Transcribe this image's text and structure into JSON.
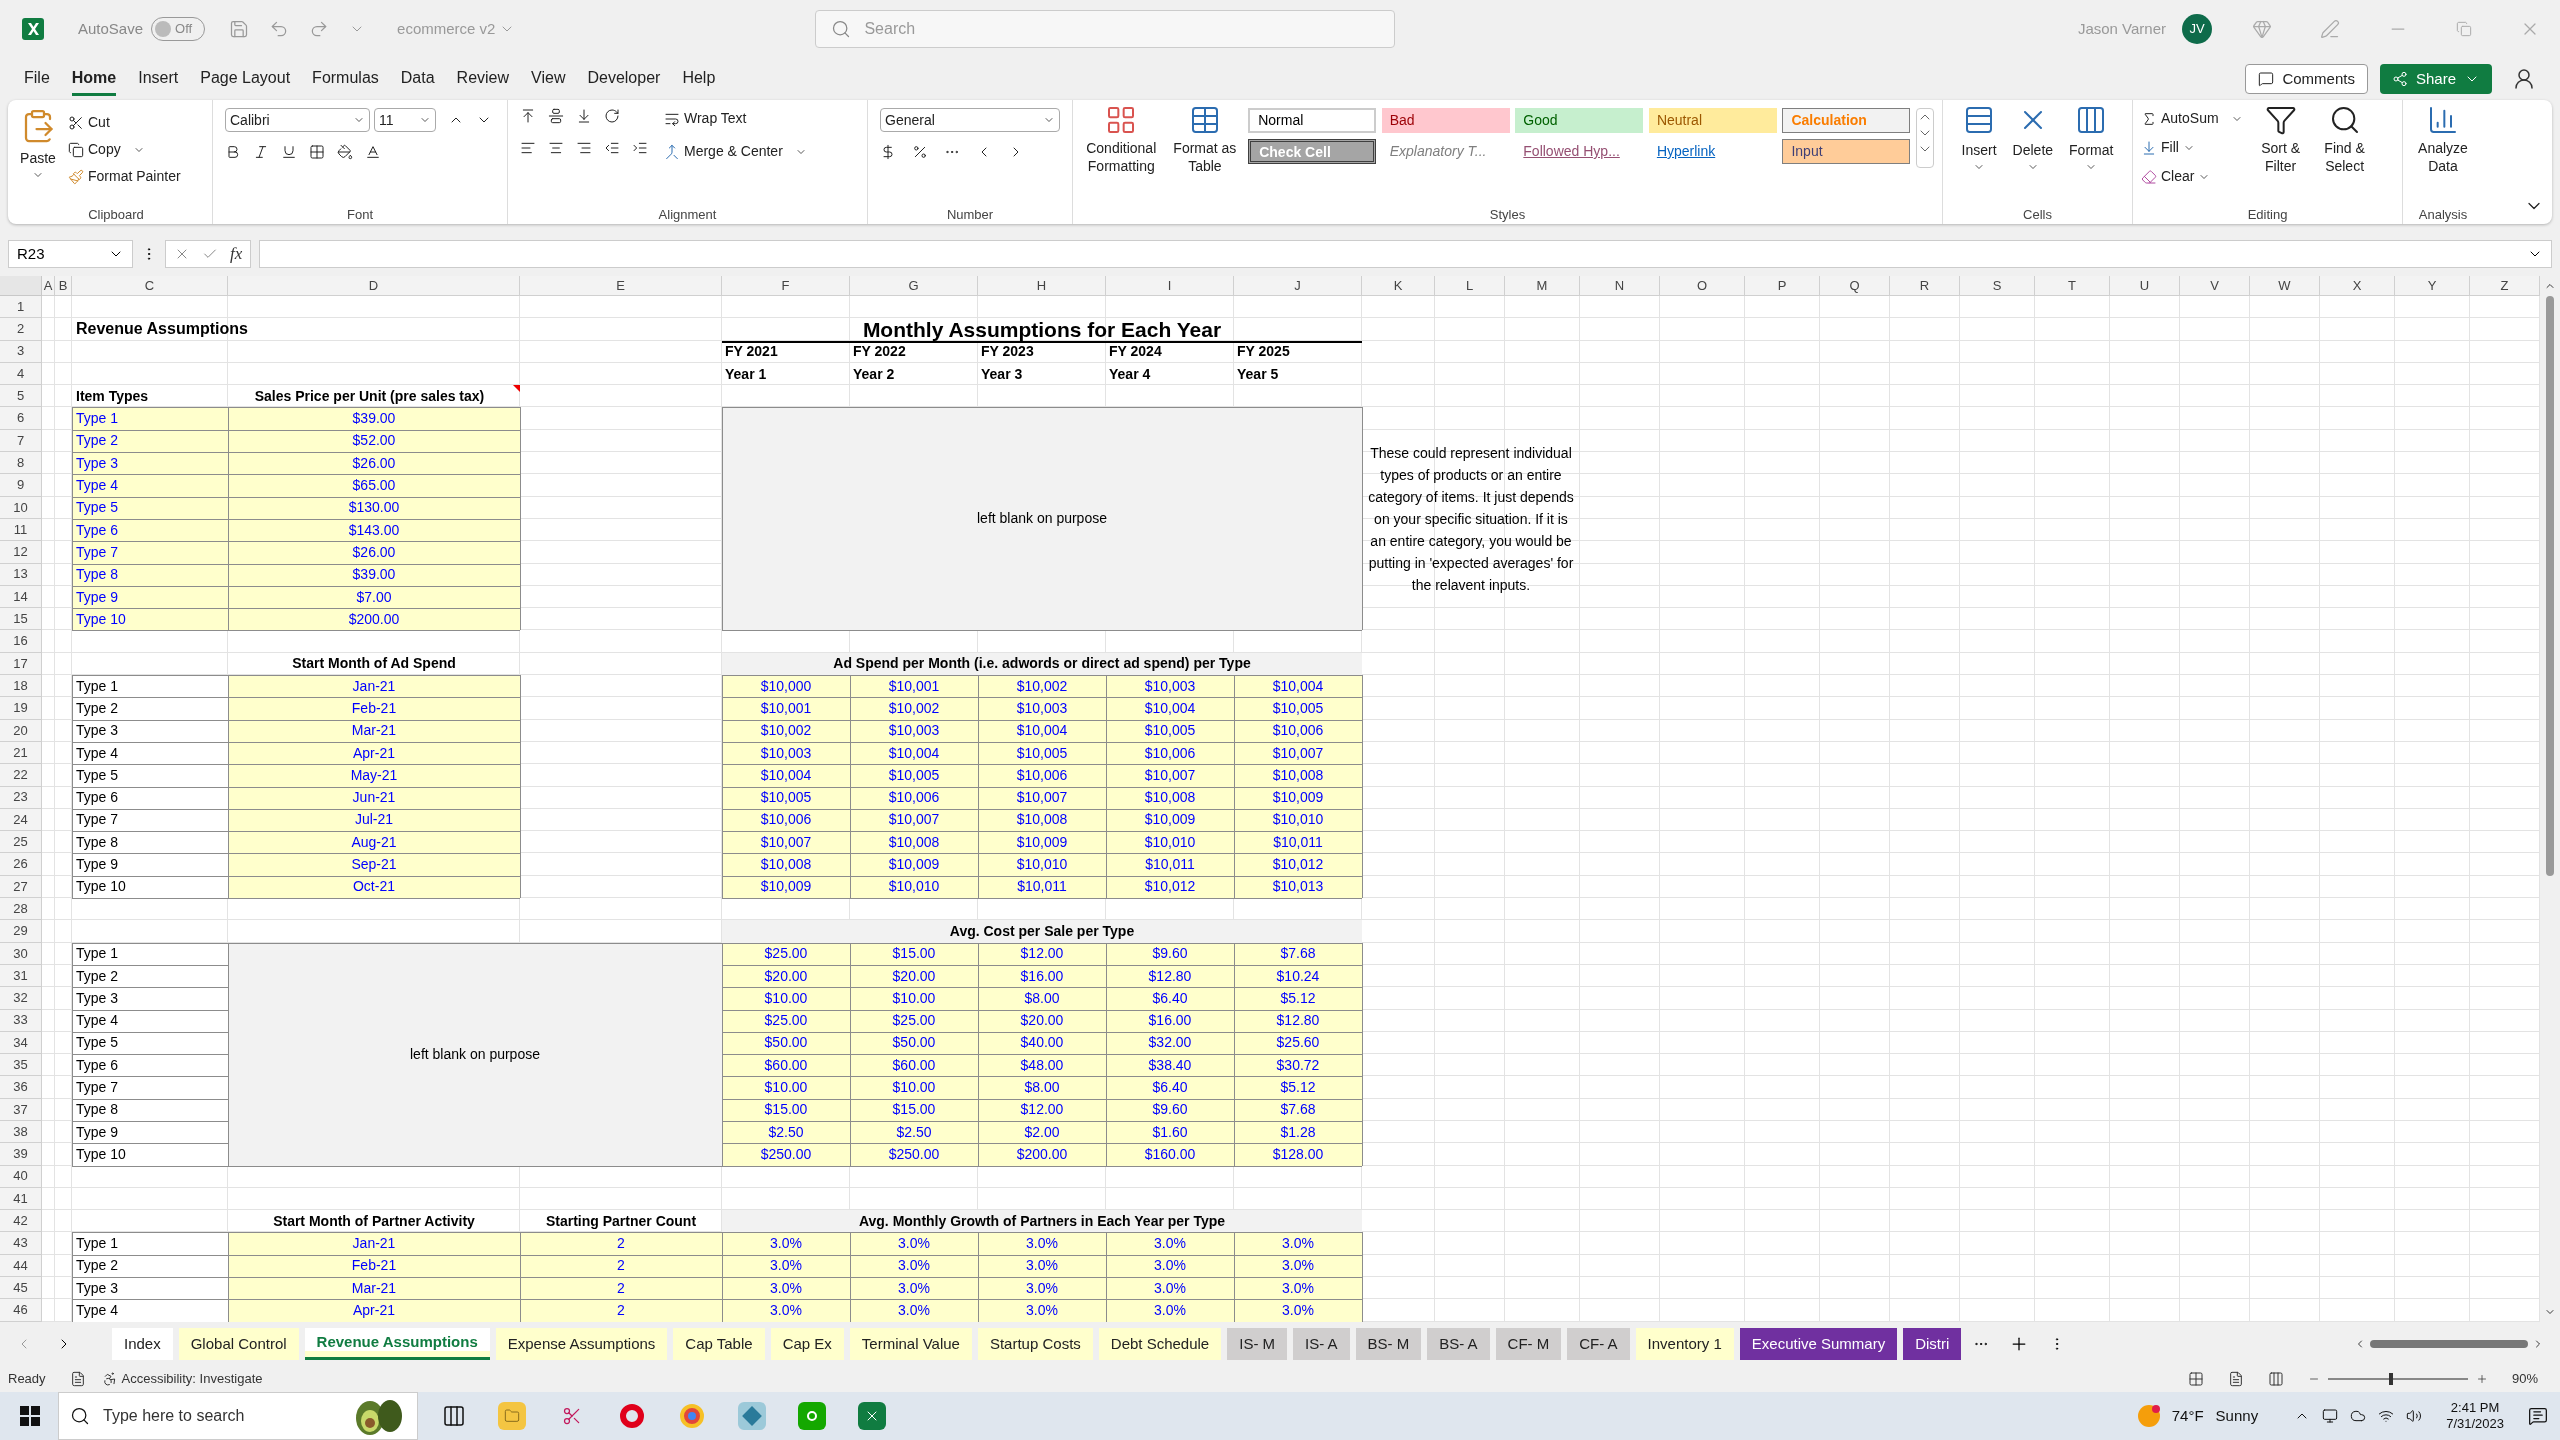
{
  "title_bar": {
    "autosave_label": "AutoSave",
    "autosave": {
      "on": false,
      "label": "Off"
    },
    "document": "ecommerce v2",
    "search_placeholder": "Search",
    "user": "Jason Varner",
    "initials": "JV"
  },
  "menu_tabs": [
    {
      "label": "File",
      "selected": false
    },
    {
      "label": "Home",
      "selected": true
    },
    {
      "label": "Insert",
      "selected": false
    },
    {
      "label": "Page Layout",
      "selected": false
    },
    {
      "label": "Formulas",
      "selected": false
    },
    {
      "label": "Data",
      "selected": false
    },
    {
      "label": "Review",
      "selected": false
    },
    {
      "label": "View",
      "selected": false
    },
    {
      "label": "Developer",
      "selected": false
    },
    {
      "label": "Help",
      "selected": false
    }
  ],
  "menu_buttons": {
    "comments": "Comments",
    "share": "Share"
  },
  "ribbon": {
    "clipboard": {
      "label": "Clipboard",
      "paste": "Paste",
      "cut": "Cut",
      "copy": "Copy",
      "format_painter": "Format Painter"
    },
    "font": {
      "label": "Font",
      "family": "Calibri",
      "size": "11"
    },
    "alignment": {
      "label": "Alignment",
      "wrap": "Wrap Text",
      "merge": "Merge & Center"
    },
    "number": {
      "label": "Number",
      "format": "General"
    },
    "styles": {
      "label": "Styles",
      "conditional": "Conditional Formatting",
      "format_table": "Format as Table",
      "gallery": [
        {
          "label": "Normal",
          "kind": "normal"
        },
        {
          "label": "Bad",
          "kind": "bad"
        },
        {
          "label": "Good",
          "kind": "good"
        },
        {
          "label": "Neutral",
          "kind": "neutral"
        },
        {
          "label": "Calculation",
          "kind": "calculation"
        },
        {
          "label": "Check Cell",
          "kind": "check"
        },
        {
          "label": "Explanatory T...",
          "kind": "explanatory"
        },
        {
          "label": "Followed Hyp...",
          "kind": "followed"
        },
        {
          "label": "Hyperlink",
          "kind": "hyperlink"
        },
        {
          "label": "Input",
          "kind": "input"
        }
      ]
    },
    "cells": {
      "label": "Cells",
      "insert": "Insert",
      "delete": "Delete",
      "format": "Format"
    },
    "editing": {
      "label": "Editing",
      "autosum": "AutoSum",
      "fill": "Fill",
      "clear": "Clear",
      "sort": "Sort & Filter",
      "find": "Find & Select"
    },
    "analysis": {
      "label": "Analysis",
      "analyze": "Analyze Data"
    }
  },
  "formula_bar": {
    "name_box": "R23",
    "function_label": "fx"
  },
  "column_headers": [
    "A",
    "B",
    "C",
    "D",
    "E",
    "F",
    "G",
    "H",
    "I",
    "J",
    "K",
    "L",
    "M",
    "N",
    "O",
    "P",
    "Q",
    "R",
    "S",
    "T",
    "U",
    "V",
    "W",
    "X",
    "Y",
    "Z"
  ],
  "row_numbers": [
    "1",
    "2",
    "3",
    "4",
    "5",
    "6",
    "7",
    "8",
    "9",
    "10",
    "11",
    "12",
    "13",
    "14",
    "15",
    "16",
    "17",
    "18",
    "19",
    "20",
    "21",
    "22",
    "23",
    "24",
    "25",
    "26",
    "27",
    "28",
    "29",
    "30",
    "31",
    "32",
    "33",
    "34",
    "35",
    "36",
    "37",
    "38",
    "39",
    "40",
    "41",
    "42",
    "43",
    "44",
    "45",
    "46"
  ],
  "sheet": {
    "title": "Revenue Assumptions",
    "monthly_title": "Monthly Assumptions for Each Year",
    "years": [
      {
        "fy": "FY 2021",
        "year": "Year 1"
      },
      {
        "fy": "FY 2022",
        "year": "Year 2"
      },
      {
        "fy": "FY 2023",
        "year": "Year 3"
      },
      {
        "fy": "FY 2024",
        "year": "Year 4"
      },
      {
        "fy": "FY 2025",
        "year": "Year 5"
      }
    ],
    "sales_price": {
      "type_header": "Item Types",
      "price_header": "Sales Price per Unit (pre sales tax)",
      "rows": [
        {
          "type": "Type 1",
          "price": "$39.00"
        },
        {
          "type": "Type 2",
          "price": "$52.00"
        },
        {
          "type": "Type 3",
          "price": "$26.00"
        },
        {
          "type": "Type 4",
          "price": "$65.00"
        },
        {
          "type": "Type 5",
          "price": "$130.00"
        },
        {
          "type": "Type 6",
          "price": "$143.00"
        },
        {
          "type": "Type 7",
          "price": "$26.00"
        },
        {
          "type": "Type 8",
          "price": "$39.00"
        },
        {
          "type": "Type 9",
          "price": "$7.00"
        },
        {
          "type": "Type 10",
          "price": "$200.00"
        }
      ]
    },
    "blank_note_top": "left blank on purpose",
    "side_note": "These could represent individual types of products or an entire category of items. It just depends on your specific situation. If it is an entire category, you would be putting in 'expected averages' for the relavent inputs.",
    "ad_spend": {
      "start_header": "Start Month of Ad Spend",
      "spend_header": "Ad Spend per Month (i.e. adwords or direct ad spend) per Type",
      "rows": [
        {
          "type": "Type 1",
          "month": "Jan-21",
          "values": [
            "$10,000",
            "$10,001",
            "$10,002",
            "$10,003",
            "$10,004"
          ]
        },
        {
          "type": "Type 2",
          "month": "Feb-21",
          "values": [
            "$10,001",
            "$10,002",
            "$10,003",
            "$10,004",
            "$10,005"
          ]
        },
        {
          "type": "Type 3",
          "month": "Mar-21",
          "values": [
            "$10,002",
            "$10,003",
            "$10,004",
            "$10,005",
            "$10,006"
          ]
        },
        {
          "type": "Type 4",
          "month": "Apr-21",
          "values": [
            "$10,003",
            "$10,004",
            "$10,005",
            "$10,006",
            "$10,007"
          ]
        },
        {
          "type": "Type 5",
          "month": "May-21",
          "values": [
            "$10,004",
            "$10,005",
            "$10,006",
            "$10,007",
            "$10,008"
          ]
        },
        {
          "type": "Type 6",
          "month": "Jun-21",
          "values": [
            "$10,005",
            "$10,006",
            "$10,007",
            "$10,008",
            "$10,009"
          ]
        },
        {
          "type": "Type 7",
          "month": "Jul-21",
          "values": [
            "$10,006",
            "$10,007",
            "$10,008",
            "$10,009",
            "$10,010"
          ]
        },
        {
          "type": "Type 8",
          "month": "Aug-21",
          "values": [
            "$10,007",
            "$10,008",
            "$10,009",
            "$10,010",
            "$10,011"
          ]
        },
        {
          "type": "Type 9",
          "month": "Sep-21",
          "values": [
            "$10,008",
            "$10,009",
            "$10,010",
            "$10,011",
            "$10,012"
          ]
        },
        {
          "type": "Type 10",
          "month": "Oct-21",
          "values": [
            "$10,009",
            "$10,010",
            "$10,011",
            "$10,012",
            "$10,013"
          ]
        }
      ]
    },
    "cost_per_sale": {
      "header": "Avg. Cost per Sale per Type",
      "blank_note": "left blank on purpose",
      "rows": [
        {
          "type": "Type 1",
          "values": [
            "$25.00",
            "$15.00",
            "$12.00",
            "$9.60",
            "$7.68"
          ]
        },
        {
          "type": "Type 2",
          "values": [
            "$20.00",
            "$20.00",
            "$16.00",
            "$12.80",
            "$10.24"
          ]
        },
        {
          "type": "Type 3",
          "values": [
            "$10.00",
            "$10.00",
            "$8.00",
            "$6.40",
            "$5.12"
          ]
        },
        {
          "type": "Type 4",
          "values": [
            "$25.00",
            "$25.00",
            "$20.00",
            "$16.00",
            "$12.80"
          ]
        },
        {
          "type": "Type 5",
          "values": [
            "$50.00",
            "$50.00",
            "$40.00",
            "$32.00",
            "$25.60"
          ]
        },
        {
          "type": "Type 6",
          "values": [
            "$60.00",
            "$60.00",
            "$48.00",
            "$38.40",
            "$30.72"
          ]
        },
        {
          "type": "Type 7",
          "values": [
            "$10.00",
            "$10.00",
            "$8.00",
            "$6.40",
            "$5.12"
          ]
        },
        {
          "type": "Type 8",
          "values": [
            "$15.00",
            "$15.00",
            "$12.00",
            "$9.60",
            "$7.68"
          ]
        },
        {
          "type": "Type 9",
          "values": [
            "$2.50",
            "$2.50",
            "$2.00",
            "$1.60",
            "$1.28"
          ]
        },
        {
          "type": "Type 10",
          "values": [
            "$250.00",
            "$250.00",
            "$200.00",
            "$160.00",
            "$128.00"
          ]
        }
      ]
    },
    "partners": {
      "start_header": "Start Month of Partner Activity",
      "count_header": "Starting Partner Count",
      "growth_header": "Avg. Monthly Growth of Partners in Each Year per Type",
      "rows": [
        {
          "type": "Type 1",
          "month": "Jan-21",
          "count": "2",
          "growth": [
            "3.0%",
            "3.0%",
            "3.0%",
            "3.0%",
            "3.0%"
          ]
        },
        {
          "type": "Type 2",
          "month": "Feb-21",
          "count": "2",
          "growth": [
            "3.0%",
            "3.0%",
            "3.0%",
            "3.0%",
            "3.0%"
          ]
        },
        {
          "type": "Type 3",
          "month": "Mar-21",
          "count": "2",
          "growth": [
            "3.0%",
            "3.0%",
            "3.0%",
            "3.0%",
            "3.0%"
          ]
        },
        {
          "type": "Type 4",
          "month": "Apr-21",
          "count": "2",
          "growth": [
            "3.0%",
            "3.0%",
            "3.0%",
            "3.0%",
            "3.0%"
          ]
        }
      ]
    }
  },
  "sheet_tabs": [
    {
      "label": "Index",
      "selected": false,
      "color": "#ffffff"
    },
    {
      "label": "Global Control",
      "selected": false,
      "color": "#ffffcc"
    },
    {
      "label": "Revenue Assumptions",
      "selected": true,
      "color": "#ffffcc"
    },
    {
      "label": "Expense Assumptions",
      "selected": false,
      "color": "#ffffcc"
    },
    {
      "label": "Cap Table",
      "selected": false,
      "color": "#ffffcc"
    },
    {
      "label": "Cap Ex",
      "selected": false,
      "color": "#ffffcc"
    },
    {
      "label": "Terminal Value",
      "selected": false,
      "color": "#ffffcc"
    },
    {
      "label": "Startup Costs",
      "selected": false,
      "color": "#ffffcc"
    },
    {
      "label": "Debt Schedule",
      "selected": false,
      "color": "#ffffcc"
    },
    {
      "label": "IS- M",
      "selected": false,
      "color": "#d0cece"
    },
    {
      "label": "IS- A",
      "selected": false,
      "color": "#d0cece"
    },
    {
      "label": "BS- M",
      "selected": false,
      "color": "#d0cece"
    },
    {
      "label": "BS- A",
      "selected": false,
      "color": "#d0cece"
    },
    {
      "label": "CF- M",
      "selected": false,
      "color": "#d0cece"
    },
    {
      "label": "CF- A",
      "selected": false,
      "color": "#d0cece"
    },
    {
      "label": "Inventory 1",
      "selected": false,
      "color": "#ffffcc"
    },
    {
      "label": "Executive Summary",
      "selected": false,
      "color": "#7030a0"
    },
    {
      "label": "Distri",
      "selected": false,
      "color": "#7030a0"
    }
  ],
  "status_bar": {
    "ready": "Ready",
    "accessibility": "Accessibility: Investigate",
    "zoom": "90%",
    "zoom_slider": {
      "level": 0.45
    }
  },
  "taskbar": {
    "search_placeholder": "Type here to search",
    "temperature": "74°F",
    "weather": "Sunny",
    "time": "2:41 PM",
    "date": "7/31/2023"
  }
}
